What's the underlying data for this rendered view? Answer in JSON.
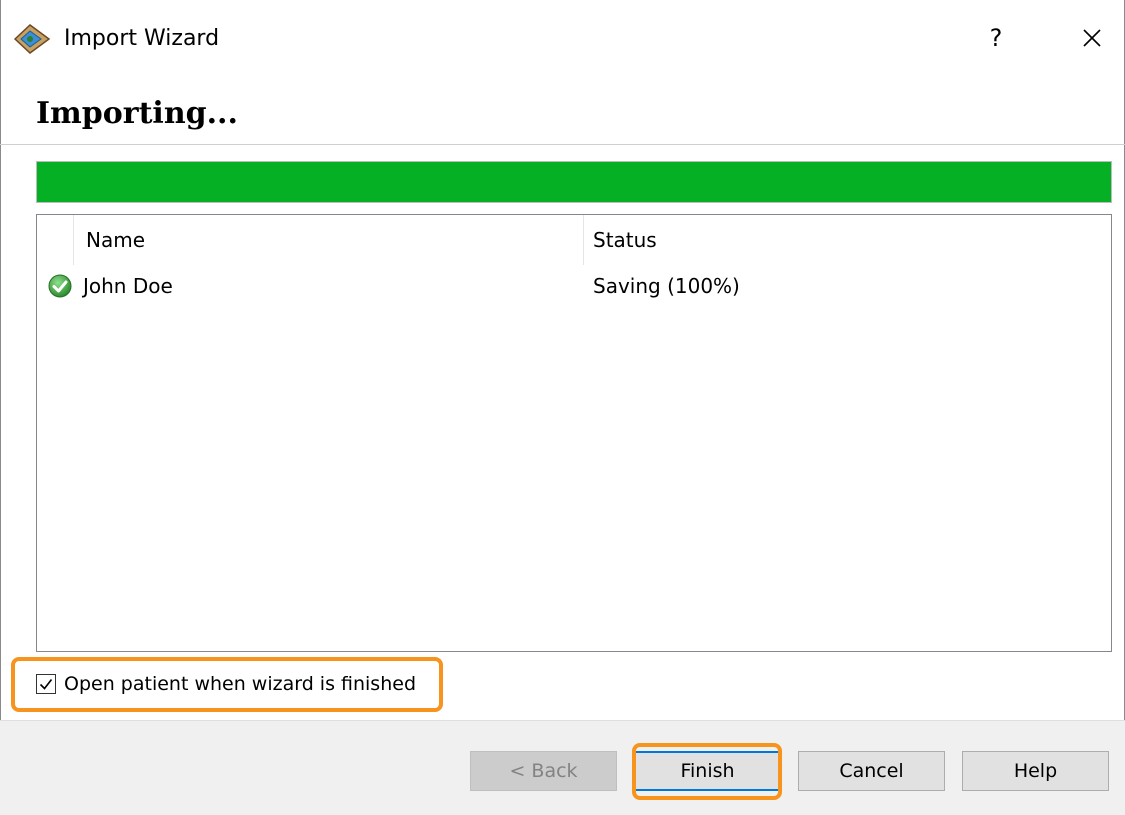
{
  "window": {
    "title": "Import Wizard",
    "icon": "import-wizard-app-icon",
    "help_label": "?",
    "close_icon": "close-icon"
  },
  "page": {
    "heading": "Importing..."
  },
  "progress": {
    "percent": 100,
    "color": "#06b025"
  },
  "list": {
    "columns": [
      "Name",
      "Status"
    ],
    "rows": [
      {
        "icon": "green-check-icon",
        "name": "John Doe",
        "status": "Saving (100%)"
      }
    ]
  },
  "options": {
    "open_patient_label": "Open patient when wizard is finished",
    "open_patient_checked": true
  },
  "buttons": {
    "back": "< Back",
    "finish": "Finish",
    "cancel": "Cancel",
    "help": "Help"
  },
  "highlight_color": "#f7941d"
}
